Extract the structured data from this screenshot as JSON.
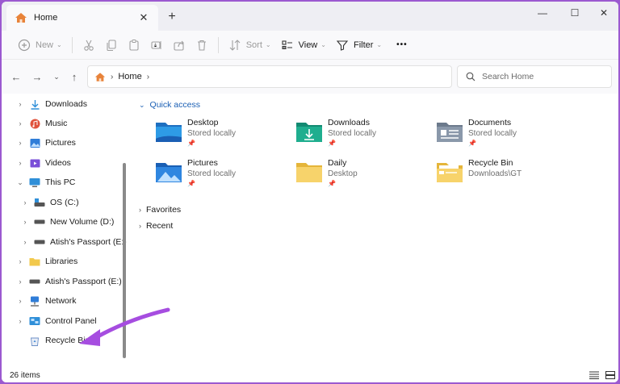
{
  "window": {
    "tab_title": "Home",
    "tab_close": "✕",
    "new_tab": "+",
    "min": "—",
    "max": "☐",
    "close": "✕"
  },
  "toolbar": {
    "new_label": "New",
    "sort_label": "Sort",
    "view_label": "View",
    "filter_label": "Filter",
    "more_label": "•••"
  },
  "address": {
    "crumb": "Home",
    "search_placeholder": "Search Home"
  },
  "sidebar": {
    "items": [
      {
        "label": "Downloads",
        "icon": "download-icon",
        "color": "#2f8fd8"
      },
      {
        "label": "Music",
        "icon": "music-icon",
        "color": "#e0533c"
      },
      {
        "label": "Pictures",
        "icon": "pictures-icon",
        "color": "#2f7dd8"
      },
      {
        "label": "Videos",
        "icon": "videos-icon",
        "color": "#7a4fd8"
      },
      {
        "label": "This PC",
        "icon": "pc-icon",
        "color": "#2f8fd8"
      },
      {
        "label": "OS (C:)",
        "icon": "drive-icon",
        "color": "#555555"
      },
      {
        "label": "New Volume (D:)",
        "icon": "drive-icon",
        "color": "#555555"
      },
      {
        "label": "Atish's Passport  (E:)",
        "icon": "drive-icon",
        "color": "#555555"
      },
      {
        "label": "Libraries",
        "icon": "libraries-icon",
        "color": "#f2c94c"
      },
      {
        "label": "Atish's Passport  (E:)",
        "icon": "drive-icon",
        "color": "#555555"
      },
      {
        "label": "Network",
        "icon": "network-icon",
        "color": "#2f7dd8"
      },
      {
        "label": "Control Panel",
        "icon": "control-panel-icon",
        "color": "#2f8fd8"
      },
      {
        "label": "Recycle Bin",
        "icon": "recycle-bin-icon",
        "color": "#6b8fc7"
      }
    ]
  },
  "main": {
    "quick_access": "Quick access",
    "favorites": "Favorites",
    "recent": "Recent",
    "tiles": [
      {
        "name": "Desktop",
        "sub": "Stored locally",
        "pinned": true,
        "icon": "desktop-folder-icon"
      },
      {
        "name": "Downloads",
        "sub": "Stored locally",
        "pinned": true,
        "icon": "downloads-folder-icon"
      },
      {
        "name": "Documents",
        "sub": "Stored locally",
        "pinned": true,
        "icon": "documents-folder-icon"
      },
      {
        "name": "Pictures",
        "sub": "Stored locally",
        "pinned": true,
        "icon": "pictures-folder-icon"
      },
      {
        "name": "Daily",
        "sub": "Desktop",
        "pinned": true,
        "icon": "folder-icon"
      },
      {
        "name": "Recycle Bin",
        "sub": "Downloads\\GT",
        "pinned": false,
        "icon": "recycle-folder-icon"
      }
    ]
  },
  "status": {
    "count": "26 items"
  },
  "colors": {
    "background": "#9b59d0",
    "accent": "#1a5fb4",
    "arrow": "#a64de0"
  }
}
